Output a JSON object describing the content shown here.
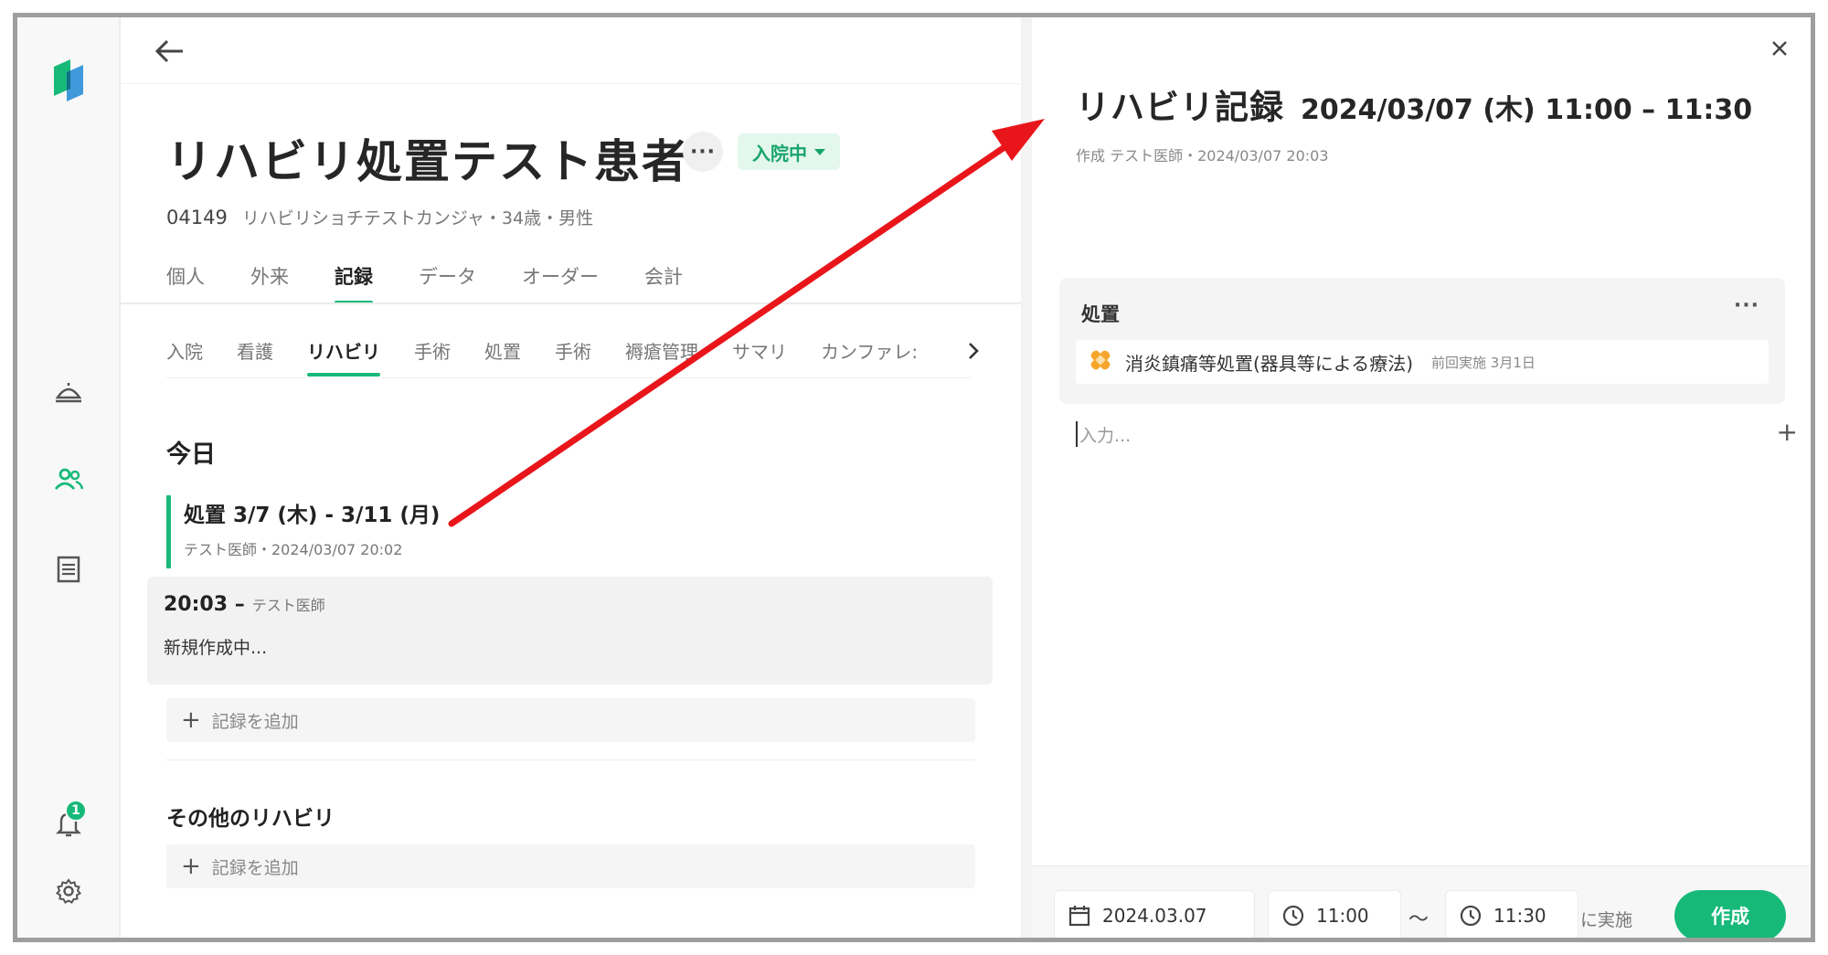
{
  "patient": {
    "name": "リハビリ処置テスト患者",
    "more": "···",
    "status": "入院中",
    "id": "04149",
    "details": "リハビリショチテストカンジャ・34歳・男性"
  },
  "tabs": [
    {
      "label": "個人",
      "active": false
    },
    {
      "label": "外来",
      "active": false
    },
    {
      "label": "記録",
      "active": true
    },
    {
      "label": "データ",
      "active": false
    },
    {
      "label": "オーダー",
      "active": false
    },
    {
      "label": "会計",
      "active": false
    }
  ],
  "subtabs": [
    {
      "label": "入院",
      "active": false
    },
    {
      "label": "看護",
      "active": false
    },
    {
      "label": "リハビリ",
      "active": true
    },
    {
      "label": "手術",
      "active": false
    },
    {
      "label": "処置",
      "active": false
    },
    {
      "label": "手術",
      "active": false
    },
    {
      "label": "褥瘡管理",
      "active": false
    },
    {
      "label": "サマリ",
      "active": false
    },
    {
      "label": "カンファレ:",
      "active": false
    }
  ],
  "today": {
    "heading": "今日",
    "entry_title": "処置 3/7 (木) - 3/11 (月)",
    "entry_sub": "テスト医師・2024/03/07 20:02",
    "draft_time": "20:03 –",
    "draft_author": "テスト医師",
    "draft_status": "新規作成中...",
    "add_label": "記録を追加"
  },
  "other": {
    "heading": "その他のリハビリ",
    "add_label": "記録を追加"
  },
  "panel": {
    "title": "リハビリ記録",
    "datetime": "2024/03/07 (木) 11:00 – 11:30",
    "sub": "作成 テスト医師・2024/03/07 20:03",
    "proc_heading": "処置",
    "proc_more": "···",
    "proc_name": "消炎鎮痛等処置(器具等による療法)",
    "proc_last": "前回実施 3月1日",
    "input_placeholder": "入力..."
  },
  "footer": {
    "date": "2024.03.07",
    "start": "11:00",
    "tilde": "〜",
    "end": "11:30",
    "done_label": "に実施",
    "create_label": "作成"
  },
  "notifications": {
    "count": "1"
  },
  "colors": {
    "accent": "#17b979",
    "annotation": "#e8161b"
  }
}
